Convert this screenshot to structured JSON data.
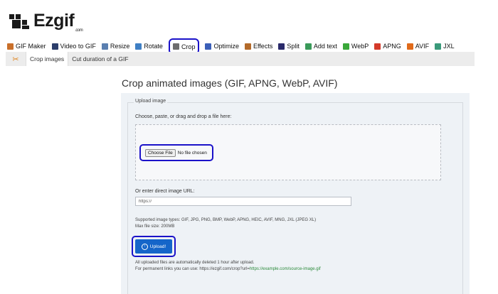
{
  "brand": {
    "name": "Ezgif",
    "suffix": ".com"
  },
  "nav": [
    {
      "label": "GIF Maker",
      "icon": "gif-maker-icon",
      "color": "#c96f2a"
    },
    {
      "label": "Video to GIF",
      "icon": "video-icon",
      "color": "#2c3e6b"
    },
    {
      "label": "Resize",
      "icon": "resize-icon",
      "color": "#5a7fb0"
    },
    {
      "label": "Rotate",
      "icon": "rotate-icon",
      "color": "#3f7fc4"
    },
    {
      "label": "Crop",
      "icon": "crop-icon",
      "color": "#6d6d6d",
      "active": true
    },
    {
      "label": "Optimize",
      "icon": "optimize-icon",
      "color": "#3b5fb8"
    },
    {
      "label": "Effects",
      "icon": "effects-icon",
      "color": "#b36a2a"
    },
    {
      "label": "Split",
      "icon": "split-icon",
      "color": "#2a2a6a"
    },
    {
      "label": "Add text",
      "icon": "add-text-icon",
      "color": "#3a9a5a"
    },
    {
      "label": "WebP",
      "icon": "webp-icon",
      "color": "#3aa83a"
    },
    {
      "label": "APNG",
      "icon": "apng-icon",
      "color": "#d43a2a"
    },
    {
      "label": "AVIF",
      "icon": "avif-icon",
      "color": "#e06a1a"
    },
    {
      "label": "JXL",
      "icon": "jxl-icon",
      "color": "#3a9a7a"
    }
  ],
  "subnav": [
    {
      "label": "Crop images",
      "active": true
    },
    {
      "label": "Cut duration of a GIF"
    }
  ],
  "page_title": "Crop animated images (GIF, APNG, WebP, AVIF)",
  "upload": {
    "legend": "Upload image",
    "drop_label": "Choose, paste, or drag and drop a file here:",
    "choose_button": "Choose File",
    "no_file": "No file chosen",
    "url_label": "Or enter direct image URL:",
    "url_value": "https://",
    "supported": "Supported image types: GIF, JPG, PNG, BMP, WebP, APNG, HEIC, AVIF, MNG, JXL (JPEG XL)",
    "max_size": "Max file size: 200MB",
    "button": "Upload!",
    "note1": "All uploaded files are automatically deleted 1 hour after upload.",
    "note2_prefix": "For permanent links you can use: https://ezgif.com/crop?url=",
    "note2_link": "https://example.com/source-image.gif"
  },
  "colors": {
    "highlight": "#1b12c9",
    "upload_button": "#1565c9",
    "panel_bg": "#eef2f6"
  }
}
